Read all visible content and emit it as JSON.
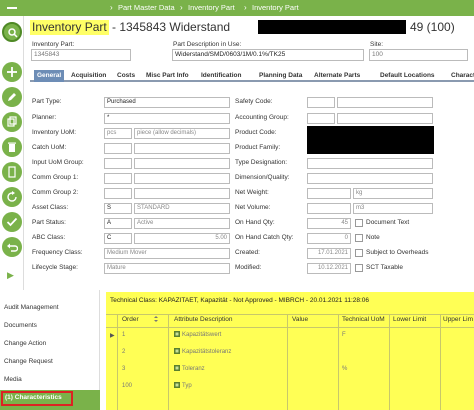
{
  "nav": {
    "breadcrumbs": [
      "Part Master Data",
      "Inventory Part",
      "Inventory Part"
    ]
  },
  "title": {
    "highlighted": "Inventory Part",
    "rest": "- 1345843 Widerstand",
    "suffix": "49 (100)"
  },
  "header": {
    "inventory_part_label": "Inventory Part:",
    "inventory_part_value": "1345843",
    "description_label": "Part Description in Use:",
    "description_value": "Widerstand/SMD/0603/1M/0.1%/TK25",
    "site_label": "Site:",
    "site_value": "100"
  },
  "tabs": [
    "General",
    "Acquisition",
    "Costs",
    "Misc Part Info",
    "Identification",
    "Planning Data",
    "Alternate Parts",
    "Default Locations",
    "Characte"
  ],
  "form_left": {
    "part_type_label": "Part Type:",
    "part_type_value": "Purchased",
    "planner_label": "Planner:",
    "planner_value": "*",
    "uom_label": "Inventory UoM:",
    "uom_value": "pcs",
    "uom_desc": "piece (allow decimals)",
    "catch_uom_label": "Catch UoM:",
    "input_uom_label": "Input UoM Group:",
    "comm1_label": "Comm Group 1:",
    "comm2_label": "Comm Group 2:",
    "asset_label": "Asset Class:",
    "asset_value": "S",
    "asset_desc": "STANDARD",
    "status_label": "Part Status:",
    "status_value": "A",
    "status_desc": "Active",
    "abc_label": "ABC Class:",
    "abc_value": "C",
    "abc_num": "5.00",
    "freq_label": "Frequency Class:",
    "freq_value": "Medium Mover",
    "lifecycle_label": "Lifecycle Stage:",
    "lifecycle_value": "Mature"
  },
  "form_right": {
    "safety_label": "Safety Code:",
    "acct_label": "Accounting Group:",
    "product_code_label": "Product Code:",
    "product_family_label": "Product Family:",
    "type_desig_label": "Type Designation:",
    "dimension_label": "Dimension/Quality:",
    "net_weight_label": "Net Weight:",
    "net_weight_unit": "kg",
    "net_volume_label": "Net Volume:",
    "net_volume_unit": "m3",
    "onhand_label": "On Hand Qty:",
    "onhand_value": "45",
    "onhand_catch_label": "On Hand Catch Qty:",
    "onhand_catch_value": "0",
    "created_label": "Created:",
    "created_value": "17.01.2021",
    "modified_label": "Modified:",
    "modified_value": "10.12.2021",
    "doc_text_label": "Document Text",
    "note_label": "Note",
    "overheads_label": "Subject to Overheads",
    "sct_label": "SCT Taxable"
  },
  "leftnav": {
    "items": [
      "Audit Management",
      "Documents",
      "Change Action",
      "Change Request",
      "Media"
    ],
    "active": "(1) Characteristics"
  },
  "characteristics": {
    "title": "Technical Class: KAPAZITAET, Kapazität - Not Approved - MIBRCH - 20.01.2021 11:28:06",
    "columns": [
      "Order",
      "Attribute Description",
      "Value",
      "Technical UoM",
      "Lower Limit",
      "Upper Lim"
    ],
    "rows": [
      {
        "order": "1",
        "attr": "Kapazitätswert",
        "uom": "F"
      },
      {
        "order": "2",
        "attr": "Kapazitätstoleranz",
        "uom": ""
      },
      {
        "order": "3",
        "attr": "Toleranz",
        "uom": "%"
      },
      {
        "order": "100",
        "attr": "Typ",
        "uom": ""
      }
    ]
  },
  "colors": {
    "brand_green": "#7ab24a",
    "tab_active": "#6d8db6",
    "highlight_yellow": "#ffff55",
    "annotation_red": "#dd2222"
  }
}
